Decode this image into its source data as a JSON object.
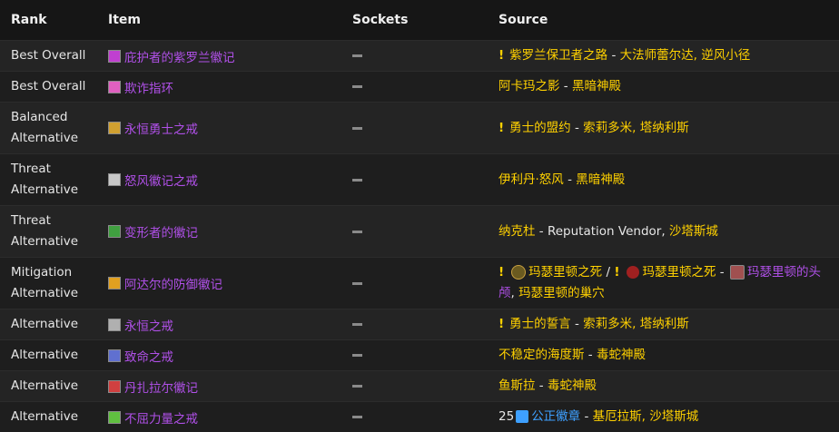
{
  "headers": {
    "rank": "Rank",
    "item": "Item",
    "sockets": "Sockets",
    "source": "Source"
  },
  "rows": [
    {
      "rank": "Best Overall",
      "item": "庇护者的紫罗兰徽记",
      "icon": "purple-rune-icon",
      "icon_color": "#c040d0",
      "quest": true,
      "source_a": "紫罗兰保卫者之路",
      "sep": " - ",
      "source_b": "大法师蕾尔达, 逆风小径"
    },
    {
      "rank": "Best Overall",
      "item": "欺诈指环",
      "icon": "pink-ring-icon",
      "icon_color": "#e060c0",
      "source_a": "阿卡玛之影",
      "sep": " - ",
      "source_b": "黑暗神殿"
    },
    {
      "rank": "Balanced Alternative",
      "item": "永恒勇士之戒",
      "icon": "gold-ring-icon",
      "icon_color": "#d0a030",
      "quest": true,
      "source_a": "勇士的盟约",
      "sep": " - ",
      "source_b": "索莉多米, 塔纳利斯"
    },
    {
      "rank": "Threat Alternative",
      "item": "怒风徽记之戒",
      "icon": "white-ring-icon",
      "icon_color": "#c8c8c8",
      "source_a": "伊利丹·怒风",
      "sep": " - ",
      "source_b": "黑暗神殿"
    },
    {
      "rank": "Threat Alternative",
      "item": "变形者的徽记",
      "icon": "green-ring-icon",
      "icon_color": "#40a040",
      "source_a": "纳克杜",
      "sep": " - ",
      "source_mid": "Reputation Vendor",
      "sep2": ", ",
      "source_b": "沙塔斯城"
    },
    {
      "rank": "Mitigation Alternative",
      "item": "阿达尔的防御徽记",
      "icon": "orange-ring-icon",
      "icon_color": "#e0a020",
      "quest": true,
      "m_a": "玛瑟里顿之死",
      "m_sep": " / ",
      "m_b": "玛瑟里顿之死",
      "m_sep2": " - ",
      "m_c": "玛瑟里顿的头颅",
      "m_sep3": ", ",
      "m_d": "玛瑟里顿的巢穴"
    },
    {
      "rank": "Alternative",
      "item": "永恒之戒",
      "icon": "silver-ring-icon",
      "icon_color": "#b0b0b0",
      "quest": true,
      "source_a": "勇士的誓言",
      "sep": " - ",
      "source_b": "索莉多米, 塔纳利斯"
    },
    {
      "rank": "Alternative",
      "item": "致命之戒",
      "icon": "blue-ring-icon",
      "icon_color": "#6070d0",
      "source_a": "不稳定的海度斯",
      "sep": " - ",
      "source_b": "毒蛇神殿"
    },
    {
      "rank": "Alternative",
      "item": "丹扎拉尔徽记",
      "icon": "red-ring-icon",
      "icon_color": "#d04040",
      "source_a": "鱼斯拉",
      "sep": " - ",
      "source_b": "毒蛇神殿"
    },
    {
      "rank": "Alternative",
      "item": "不屈力量之戒",
      "icon": "green-glyph-icon",
      "icon_color": "#60c040",
      "badge_count": "25",
      "badge_name": "公正徽章",
      "sep": " - ",
      "source_b": "基厄拉斯, 沙塔斯城"
    }
  ],
  "sockets_placeholder": "—",
  "colors": {
    "item": "#b050e8",
    "source": "#ffd100",
    "badge": "#3ea0ff"
  }
}
